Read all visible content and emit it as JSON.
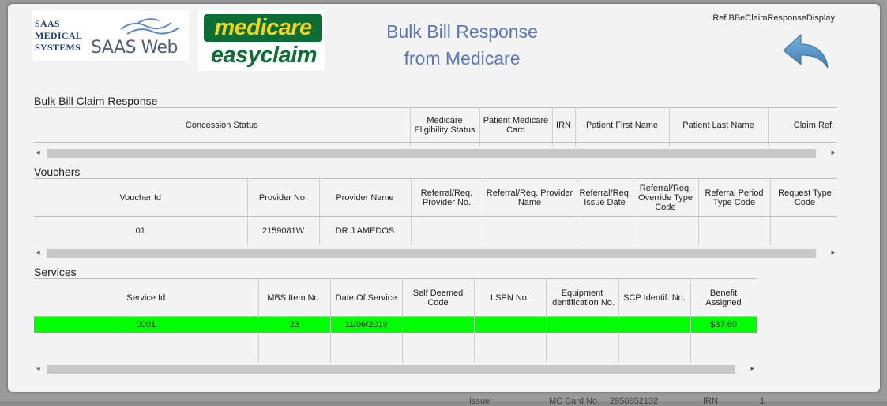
{
  "backdrop": {
    "bottom_labels": [
      "Issue",
      "MC Card No.",
      "2950852132",
      "IRN",
      "1"
    ]
  },
  "header": {
    "saas_logo_small": [
      "SAAS",
      "MEDICAL",
      "SYSTEMS"
    ],
    "saas_logo_big": "SAAS Web",
    "medicare_top": "medicare",
    "medicare_bottom": "easyclaim",
    "title_line1": "Bulk Bill Response",
    "title_line2": "from Medicare",
    "ref": "Ref.BBeClaimResponseDisplay"
  },
  "claim": {
    "title": "Bulk Bill Claim Response",
    "columns": [
      "Concession Status",
      "Medicare Eligibility Status",
      "Patient Medicare Card",
      "IRN",
      "Patient First Name",
      "Patient Last Name",
      "Claim Ref. ID"
    ]
  },
  "vouchers": {
    "title": "Vouchers",
    "columns": [
      "Voucher Id",
      "Provider No.",
      "Provider Name",
      "Referral/Req. Provider No.",
      "Referral/Req. Provider Name",
      "Referral/Req. Issue Date",
      "Referral/Req. Override Type Code",
      "Referral Period Type Code",
      "Request Type Code"
    ],
    "rows": [
      [
        "01",
        "2159081W",
        "DR J AMEDOS",
        "",
        "",
        "",
        "",
        "",
        ""
      ]
    ]
  },
  "services": {
    "title": "Services",
    "columns": [
      "Service Id",
      "MBS Item No.",
      "Date Of Service",
      "Self Deemed Code",
      "LSPN No.",
      "Equipment Identification No.",
      "SCP Identif. No.",
      "Benefit Assigned"
    ],
    "rows": [
      [
        "0001",
        "23",
        "11/06/2019",
        "",
        "",
        "",
        "",
        "$37.60"
      ]
    ]
  },
  "icons": {
    "back": "back-arrow-icon",
    "scroll_left": "◂",
    "scroll_right": "▸"
  },
  "colors": {
    "title": "#5a78b8",
    "highlight_row": "#00ff00",
    "medicare_green": "#0d6e35",
    "medicare_yellow": "#f7d31a",
    "back_arrow": "#4a8fc4"
  }
}
